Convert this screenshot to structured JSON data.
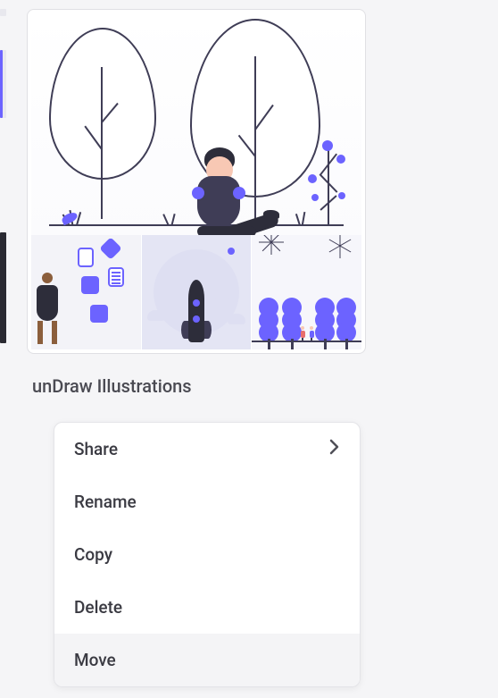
{
  "asset": {
    "title": "unDraw Illustrations"
  },
  "context_menu": {
    "items": [
      {
        "label": "Share",
        "has_submenu": true
      },
      {
        "label": "Rename",
        "has_submenu": false
      },
      {
        "label": "Copy",
        "has_submenu": false
      },
      {
        "label": "Delete",
        "has_submenu": false
      },
      {
        "label": "Move",
        "has_submenu": false
      }
    ],
    "selected_index": 4
  },
  "colors": {
    "accent": "#6c63ff",
    "dark": "#3f3d56",
    "text": "#3a3a42"
  }
}
